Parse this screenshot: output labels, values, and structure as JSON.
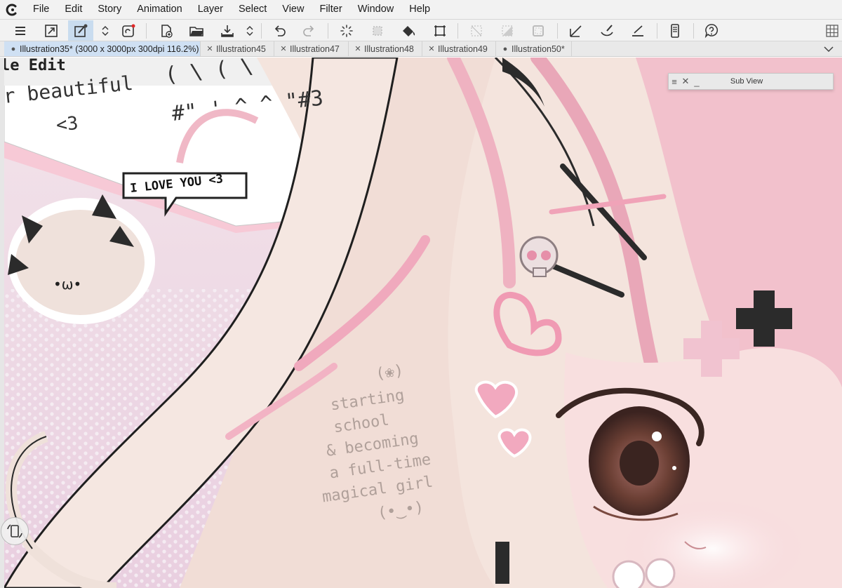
{
  "menubar": {
    "items": [
      "File",
      "Edit",
      "Story",
      "Animation",
      "Layer",
      "Select",
      "View",
      "Filter",
      "Window",
      "Help"
    ]
  },
  "toolbar": {
    "tools": [
      "main-menu",
      "fit-canvas",
      "quick-access",
      "stepper",
      "companion",
      "new-canvas",
      "open-file",
      "save",
      "stepper",
      "undo",
      "redo",
      "loading-spinner",
      "clear-selection",
      "fill",
      "transform",
      "deselect",
      "invert-selection",
      "show-selection",
      "pen-stabilizer",
      "brush-size",
      "ruler-snap",
      "smartphone",
      "help"
    ]
  },
  "tabs": [
    {
      "label": "Illustration35* (3000 x 3000px 300dpi 116.2%)",
      "mark": "●",
      "active": true
    },
    {
      "label": "Illustration45",
      "mark": "✕",
      "active": false
    },
    {
      "label": "Illustration47",
      "mark": "✕",
      "active": false
    },
    {
      "label": "Illustration48",
      "mark": "✕",
      "active": false
    },
    {
      "label": "Illustration49",
      "mark": "✕",
      "active": false
    },
    {
      "label": "Illustration50*",
      "mark": "●",
      "active": false
    }
  ],
  "subview": {
    "title": "Sub View",
    "menu_glyph": "≡",
    "close_glyph": "✕",
    "minimize_glyph": "_"
  },
  "canvas": {
    "window_menu": "le   Edit",
    "window_text_1": "r beautiful",
    "window_text_2": "<3",
    "kaomoji_1": "( \\      ( \\",
    "kaomoji_2": "#\"  ' ^ ^  \"#3",
    "speech_bubble": "I LOVE YOU <3",
    "chibi_face": "•ω•",
    "note_lines": [
      "(❀)",
      "starting",
      "school",
      "& becoming",
      "a full-time",
      "magical girl",
      "(•‿•)"
    ]
  },
  "colors": {
    "hair_pink": "#f2c6cf",
    "hair_cream": "#f4e6e0",
    "accent_pink": "#e8a1b4",
    "dark": "#2b2b2b",
    "eye_brown": "#6b3f34",
    "tab_active": "#cfe0f3"
  }
}
